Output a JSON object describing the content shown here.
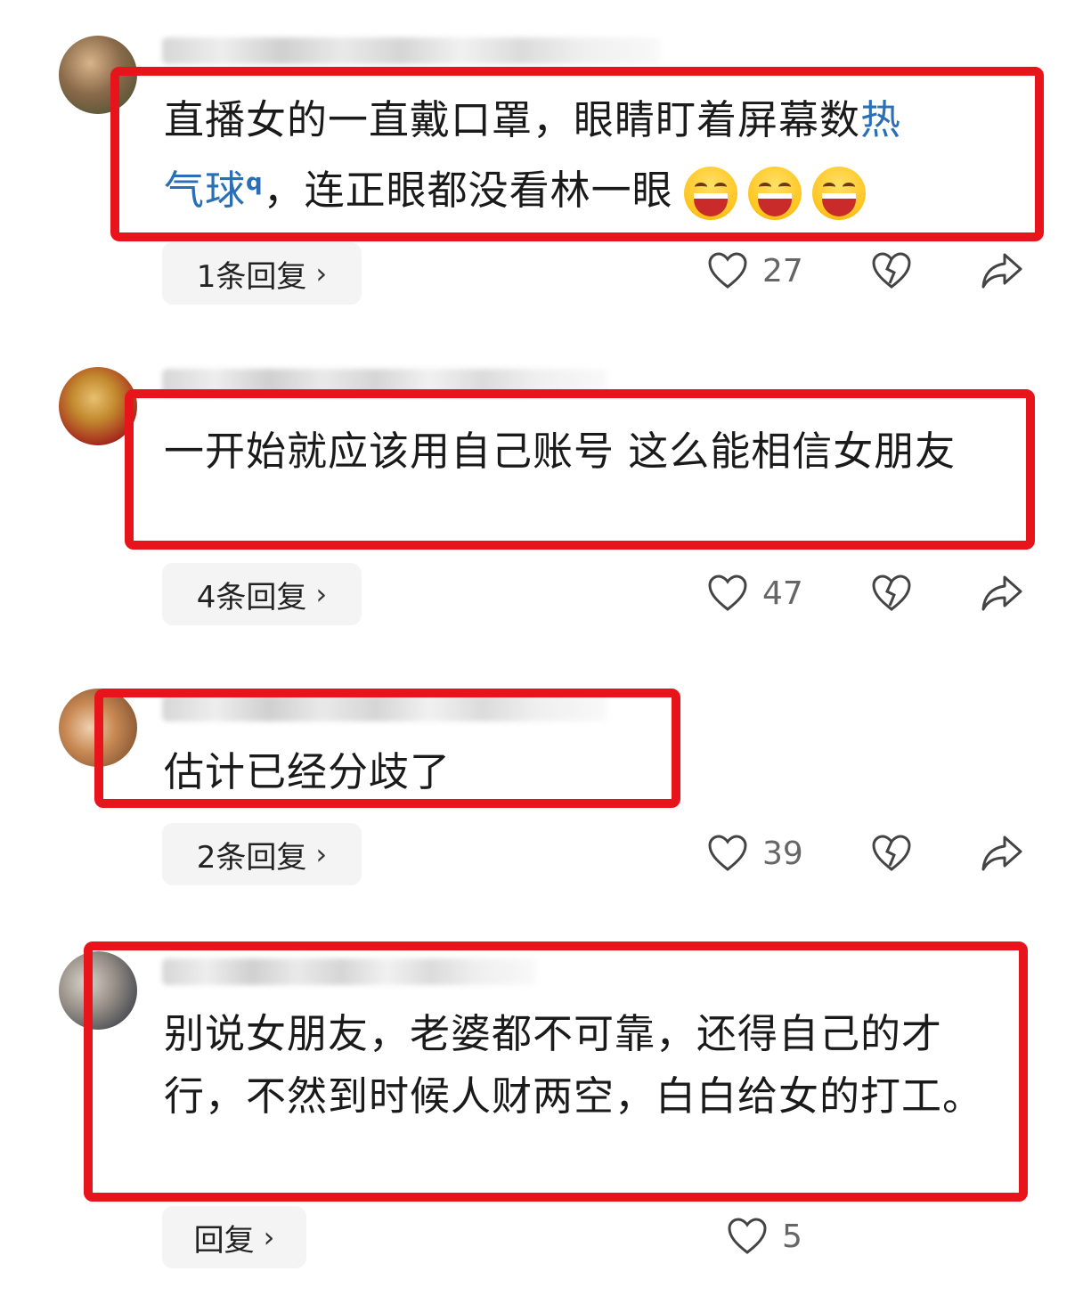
{
  "comments": [
    {
      "text_a": "直播女的一直戴口罩，眼睛盯着屏幕数",
      "link_a": "热",
      "link_b": "气球",
      "text_b": "，连正眼都没看林一眼",
      "emoji_count": 3,
      "reply_label": "1条回复",
      "likes": "27"
    },
    {
      "text": "一开始就应该用自己账号 这么能相信女朋友",
      "reply_label": "4条回复",
      "likes": "47"
    },
    {
      "text": "估计已经分歧了",
      "reply_label": "2条回复",
      "likes": "39"
    },
    {
      "text": "别说女朋友，老婆都不可靠，还得自己的才行，不然到时候人财两空，白白给女的打工。",
      "reply_label": "回复",
      "likes": "5"
    }
  ],
  "icons": {
    "like": "heart-outline-icon",
    "dislike": "broken-heart-icon",
    "share": "share-arrow-icon",
    "emoji": "laughing-emoji-icon"
  },
  "colors": {
    "highlight_box": "#e8141c",
    "link": "#2a6fb5",
    "reply_button_bg": "#f4f4f4"
  }
}
